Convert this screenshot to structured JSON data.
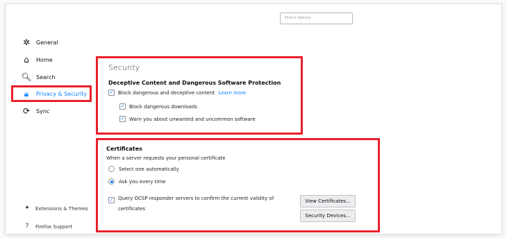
{
  "search": {
    "placeholder": "Find in Options"
  },
  "sidebar": {
    "items": [
      {
        "label": "General",
        "icon": "gear-icon"
      },
      {
        "label": "Home",
        "icon": "home-icon"
      },
      {
        "label": "Search",
        "icon": "search-icon"
      },
      {
        "label": "Privacy & Security",
        "icon": "lock-icon"
      },
      {
        "label": "Sync",
        "icon": "sync-icon"
      }
    ],
    "footer": [
      {
        "label": "Extensions & Themes",
        "icon": "puzzle-icon"
      },
      {
        "label": "Firefox Support",
        "icon": "help-icon"
      }
    ]
  },
  "security": {
    "title": "Security",
    "heading": "Deceptive Content and Dangerous Software Protection",
    "block_deceptive": "Block dangerous and deceptive content",
    "learn_more": "Learn more",
    "block_downloads": "Block dangerous downloads",
    "warn_unwanted": "Warn you about unwanted and uncommon software"
  },
  "certificates": {
    "heading": "Certificates",
    "prompt": "When a server requests your personal certificate",
    "option_auto": "Select one automatically",
    "option_ask": "Ask you every time",
    "ocsp_line1": "Query OCSP responder servers to confirm the current validity of",
    "ocsp_line2": "certificates",
    "view_button": "View Certificates...",
    "devices_button": "Security Devices..."
  },
  "colors": {
    "accent": "#0a84ff",
    "highlight": "#e8202a"
  }
}
